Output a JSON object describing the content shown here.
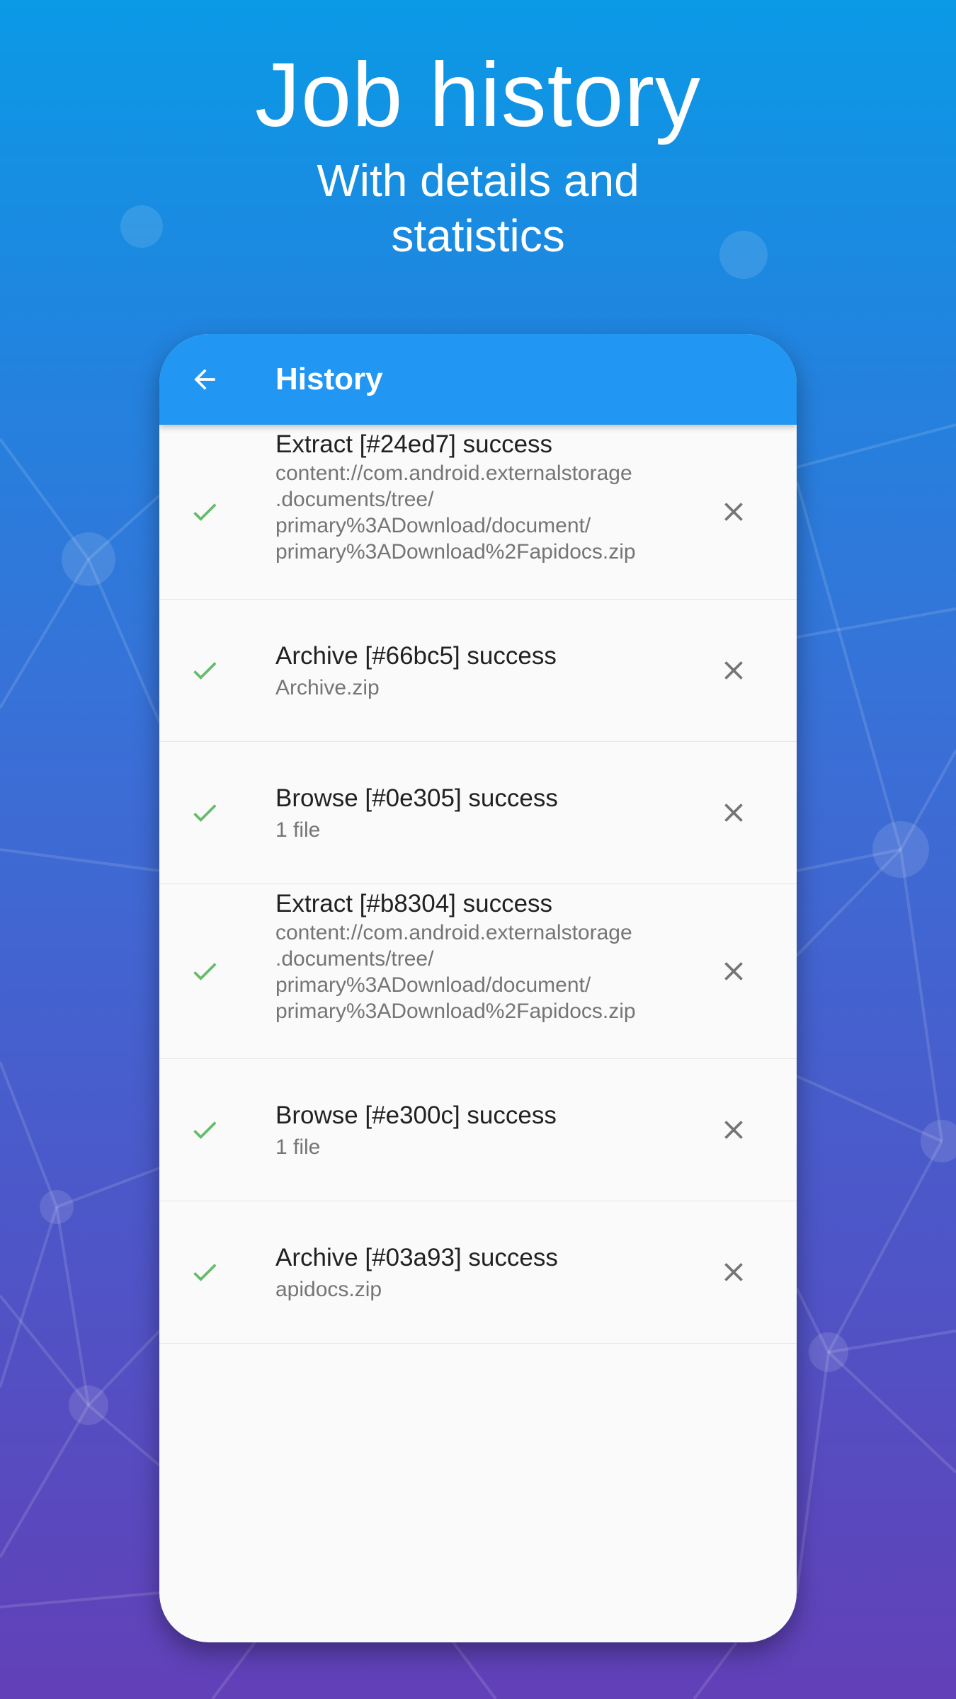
{
  "hero": {
    "title": "Job history",
    "subtitle_line1": "With details and",
    "subtitle_line2": "statistics"
  },
  "app": {
    "title": "History",
    "back_icon": "arrow-back-icon",
    "status_icon": "check-icon",
    "remove_icon": "close-icon",
    "colors": {
      "appbar": "#2196f3",
      "success": "#66bb6a",
      "remove": "#757575"
    }
  },
  "history": [
    {
      "title": "Extract [#24ed7] success",
      "details": [
        "content://com.android.externalstorage",
        ".documents/tree/",
        "primary%3ADownload/document/",
        "primary%3ADownload%2Fapidocs.zip"
      ]
    },
    {
      "title": "Archive [#66bc5] success",
      "details": [
        "Archive.zip"
      ]
    },
    {
      "title": "Browse [#0e305] success",
      "details": [
        "1 file"
      ]
    },
    {
      "title": "Extract [#b8304] success",
      "details": [
        "content://com.android.externalstorage",
        ".documents/tree/",
        "primary%3ADownload/document/",
        "primary%3ADownload%2Fapidocs.zip"
      ]
    },
    {
      "title": "Browse [#e300c] success",
      "details": [
        "1 file"
      ]
    },
    {
      "title": "Archive [#03a93] success",
      "details": [
        "apidocs.zip"
      ]
    }
  ]
}
